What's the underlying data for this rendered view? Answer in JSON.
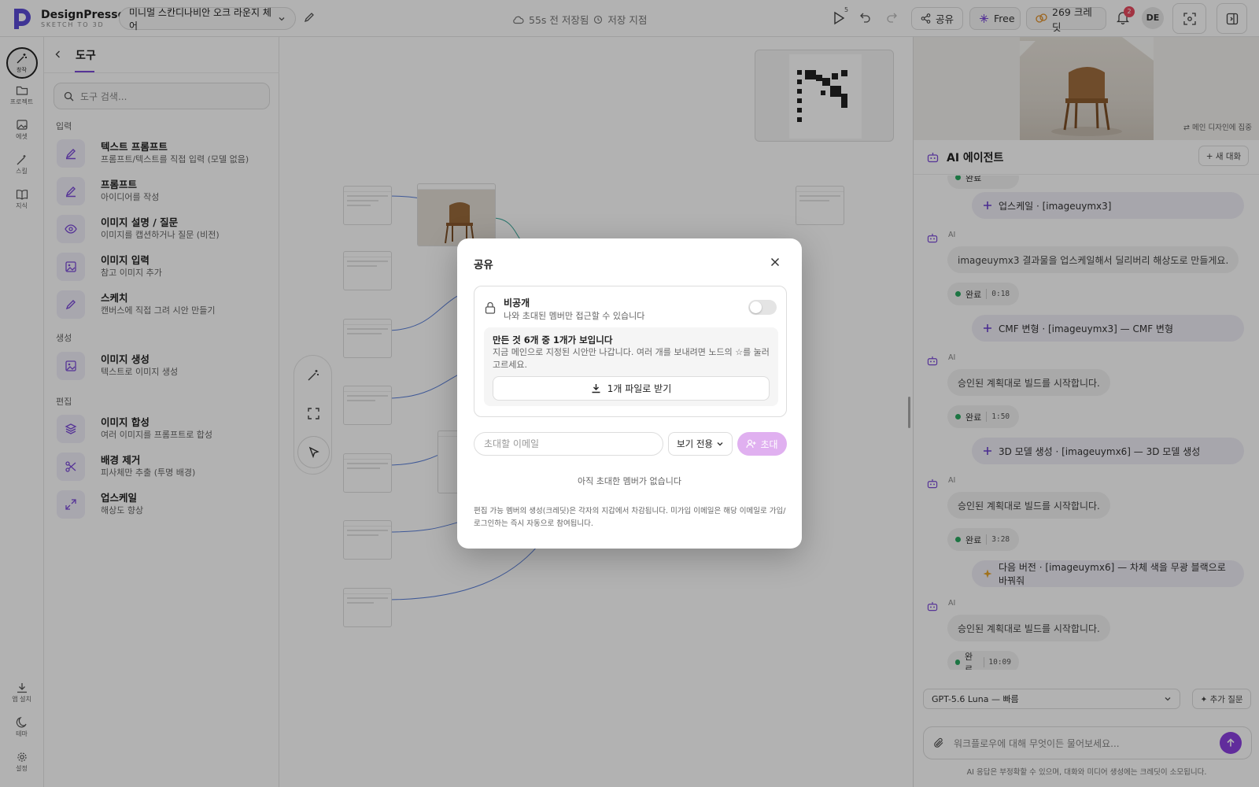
{
  "header": {
    "brand": "DesignPresso",
    "brand_sub": "SKETCH TO 3D",
    "project_title": "미니멀 스칸디나비안 오크 라운지 체어",
    "saved_status": "55s 전 저장됨",
    "save_point": "저장 지점",
    "run_count": "5",
    "share_label": "공유",
    "plan_label": "Free",
    "credits_label": "269 크레딧",
    "notification_count": "2",
    "avatar_initials": "DE"
  },
  "rail": {
    "items": [
      {
        "label": "창작",
        "icon": "sparkle-wand-icon"
      },
      {
        "label": "프로젝트",
        "icon": "folder-icon"
      },
      {
        "label": "에셋",
        "icon": "images-icon"
      },
      {
        "label": "스킬",
        "icon": "wand-icon"
      },
      {
        "label": "지식",
        "icon": "book-icon"
      }
    ],
    "bottom": [
      {
        "label": "앱 설치",
        "icon": "download-icon"
      },
      {
        "label": "테마",
        "icon": "moon-icon"
      },
      {
        "label": "설정",
        "icon": "gear-icon"
      }
    ]
  },
  "tools": {
    "title": "도구",
    "search_placeholder": "도구 검색...",
    "sections": [
      {
        "label": "입력"
      },
      {
        "label": "생성"
      },
      {
        "label": "편집"
      }
    ],
    "items": [
      {
        "title": "텍스트 프롬프트",
        "desc": "프롬프트/텍스트를 직접 입력 (모델 없음)",
        "icon": "pencil-icon"
      },
      {
        "title": "프롬프트",
        "desc": "아이디어를 작성",
        "icon": "pencil-icon"
      },
      {
        "title": "이미지 설명 / 질문",
        "desc": "이미지를 캡션하거나 질문 (비전)",
        "icon": "eye-icon"
      },
      {
        "title": "이미지 입력",
        "desc": "참고 이미지 추가",
        "icon": "image-icon"
      },
      {
        "title": "스케치",
        "desc": "캔버스에 직접 그려 시안 만들기",
        "icon": "pen-icon"
      },
      {
        "title": "이미지 생성",
        "desc": "텍스트로 이미지 생성",
        "icon": "image-icon"
      },
      {
        "title": "이미지 합성",
        "desc": "여러 이미지를 프롬프트로 합성",
        "icon": "layers-icon"
      },
      {
        "title": "배경 제거",
        "desc": "피사체만 추출 (투명 배경)",
        "icon": "scissors-icon"
      },
      {
        "title": "업스케일",
        "desc": "해상도 향상",
        "icon": "expand-icon"
      }
    ]
  },
  "right_panel": {
    "focus_note": "⇄ 메인 디자인에 집중",
    "agent_title": "AI 에이전트",
    "new_chat": "+ 새 대화",
    "ai_label": "AI",
    "status_done": "완료",
    "messages": [
      {
        "type": "action",
        "icon": "plus",
        "text": "업스케일 · [imageuymx3]"
      },
      {
        "type": "ai",
        "text": "imageuymx3 결과물을 업스케일해서 딜리버리 해상도로 만들게요.",
        "time": "0:18"
      },
      {
        "type": "action",
        "icon": "plus",
        "text": "CMF 변형 · [imageuymx3] — CMF 변형"
      },
      {
        "type": "ai",
        "text": "승인된 계획대로 빌드를 시작합니다.",
        "time": "1:50"
      },
      {
        "type": "action",
        "icon": "plus",
        "text": "3D 모델 생성 · [imageuymx6] — 3D 모델 생성"
      },
      {
        "type": "ai",
        "text": "승인된 계획대로 빌드를 시작합니다.",
        "time": "3:28"
      },
      {
        "type": "action",
        "icon": "sparkle",
        "text": "다음 버전 · [imageuymx6] — 차체 색을 무광 블랙으로 바꿔줘"
      },
      {
        "type": "ai",
        "text": "승인된 계획대로 빌드를 시작합니다.",
        "time": "10:09"
      }
    ],
    "model": "GPT-5.6 Luna — 빠름",
    "add_question": "✦ 추가 질문",
    "composer_placeholder": "워크플로우에 대해 무엇이든 물어보세요...",
    "disclaimer": "AI 응답은 부정확할 수 있으며, 대화와 미디어 생성에는 크레딧이 소모됩니다."
  },
  "share_modal": {
    "title": "공유",
    "privacy_title": "비공개",
    "privacy_desc": "나와 초대된 멤버만 접근할 수 있습니다",
    "private_toggle_on": false,
    "shown_title": "만든 것 6개 중 1개가 보입니다",
    "shown_desc": "지금 메인으로 지정된 시안만 나갑니다. 여러 개를 보내려면 노드의 ☆를 눌러 고르세요.",
    "download_label": "1개 파일로 받기",
    "email_placeholder": "초대할 이메일",
    "role_value": "보기 전용",
    "invite_label": "초대",
    "no_members": "아직 초대한 멤버가 없습니다",
    "footnote": "편집 가능 멤버의 생성(크레딧)은 각자의 지갑에서 차감됩니다. 미가입 이메일은 해당 이메일로 가입/로그인하는 즉시 자동으로 참여됩니다."
  },
  "colors": {
    "accent": "#7c4bd8",
    "send": "#8b3fe0",
    "invite": "#e0b0f0",
    "done_dot": "#2aa860",
    "badge": "#e84a5f"
  }
}
